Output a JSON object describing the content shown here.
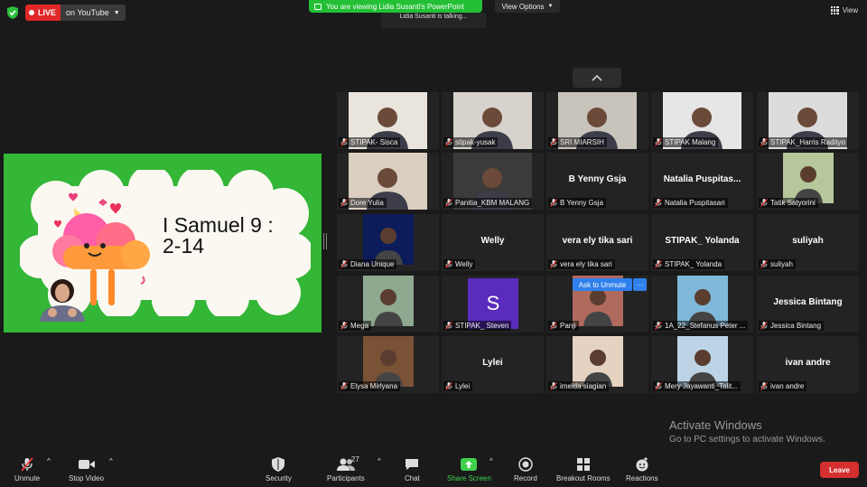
{
  "topbar": {
    "live_label": "LIVE",
    "stream_label": "on YouTube",
    "viewing_banner": "You are viewing Lidia Susanti's PowerPoint",
    "talking_indicator": "Lidia Susanti is talking...",
    "view_options_label": "View Options",
    "view_label": "View"
  },
  "slide": {
    "title_line1": "I Samuel 9 :",
    "title_line2": "2-14"
  },
  "tiles": [
    {
      "label": "STIPAK- Sisca",
      "type": "photo",
      "col": 0,
      "row": 0,
      "bg": "#e9e4dc"
    },
    {
      "label": "stipak-yusak",
      "type": "photo",
      "col": 1,
      "row": 0,
      "bg": "#d7d2cc"
    },
    {
      "label": "SRI MIARSIH",
      "type": "photo",
      "col": 2,
      "row": 0,
      "bg": "#c9c4bb"
    },
    {
      "label": "STIPAK Malang",
      "type": "photo",
      "col": 3,
      "row": 0,
      "bg": "#e6e6e6"
    },
    {
      "label": "STIPAK_Harris Radityo",
      "type": "photo",
      "col": 4,
      "row": 0,
      "bg": "#dcdcdc"
    },
    {
      "label": "Dore Yulia",
      "type": "photo",
      "col": 0,
      "row": 1,
      "bg": "#d9cec0"
    },
    {
      "label": "Panitia_KBM MALANG",
      "type": "photo",
      "col": 1,
      "row": 1,
      "bg": "#3b3b3b"
    },
    {
      "label": "B Yenny Gsja",
      "type": "name",
      "name": "B Yenny Gsja",
      "col": 2,
      "row": 1
    },
    {
      "label": "Natalia Puspitasari",
      "type": "name",
      "name": "Natalia Puspitas...",
      "col": 3,
      "row": 1
    },
    {
      "label": "Tatik Satyorini",
      "type": "photo-small",
      "col": 4,
      "row": 1,
      "bg": "#b5c79b"
    },
    {
      "label": "Diana Unique",
      "type": "photo-small",
      "col": 0,
      "row": 2,
      "bg": "#0c1c5a"
    },
    {
      "label": "Welly",
      "type": "name",
      "name": "Welly",
      "col": 1,
      "row": 2
    },
    {
      "label": "vera ely tika sari",
      "type": "name",
      "name": "vera ely tika sari",
      "col": 2,
      "row": 2
    },
    {
      "label": "STIPAK_ Yolanda",
      "type": "name",
      "name": "STIPAK_ Yolanda",
      "col": 3,
      "row": 2
    },
    {
      "label": "suliyah",
      "type": "name",
      "name": "suliyah",
      "col": 4,
      "row": 2
    },
    {
      "label": "Mega",
      "type": "photo-small",
      "col": 0,
      "row": 3,
      "bg": "#8fa890"
    },
    {
      "label": "STIPAK_ Steven",
      "type": "avatar",
      "initial": "S",
      "col": 1,
      "row": 3
    },
    {
      "label": "Panji",
      "type": "photo-small",
      "col": 2,
      "row": 3,
      "bg": "#b06a5d"
    },
    {
      "label": "1A_22_Stefanus Peter ...",
      "type": "photo-small",
      "col": 3,
      "row": 3,
      "bg": "#7fb8d8"
    },
    {
      "label": "Jessica Bintang",
      "type": "name",
      "name": "Jessica Bintang",
      "col": 4,
      "row": 3
    },
    {
      "label": "Elysa Mirlyana",
      "type": "photo-small",
      "col": 0,
      "row": 4,
      "bg": "#7a5236"
    },
    {
      "label": "Lylei",
      "type": "name",
      "name": "Lylei",
      "col": 1,
      "row": 4
    },
    {
      "label": "imelda siagian",
      "type": "photo-small",
      "col": 2,
      "row": 4,
      "bg": "#e5d2c0"
    },
    {
      "label": "Mery Jayawanti_Talit...",
      "type": "photo-small",
      "col": 3,
      "row": 4,
      "bg": "#bcd4e6"
    },
    {
      "label": "ivan andre",
      "type": "name",
      "name": "ivan andre",
      "col": 4,
      "row": 4
    }
  ],
  "ask_to_unmute": "Ask to Unmute",
  "more_dots": "···",
  "watermark": {
    "line1": "Activate Windows",
    "line2": "Go to PC settings to activate Windows."
  },
  "toolbar": {
    "unmute": "Unmute",
    "stop_video": "Stop Video",
    "security": "Security",
    "participants": "Participants",
    "participants_count": "27",
    "chat": "Chat",
    "share_screen": "Share Screen",
    "record": "Record",
    "breakout_rooms": "Breakout Rooms",
    "reactions": "Reactions",
    "leave": "Leave"
  },
  "colors": {
    "share_green": "#23c035",
    "slide_green": "#34b636",
    "leave_red": "#d3302f",
    "live_red": "#e02828",
    "accent_blue": "#2f80ed",
    "avatar_purple": "#5a2bbd"
  }
}
